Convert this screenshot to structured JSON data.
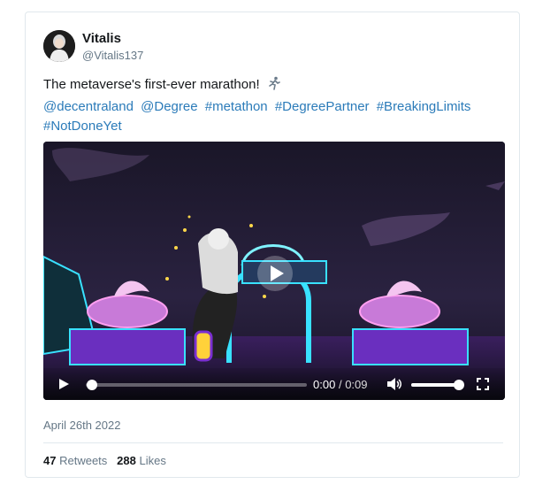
{
  "user": {
    "name": "Vitalis",
    "handle": "@Vitalis137"
  },
  "tweet": {
    "text": "The metaverse's first-ever marathon!",
    "emoji_icon": "person-running-icon",
    "links": [
      "@decentraland",
      "@Degree",
      "#metathon",
      "#DegreePartner",
      "#BreakingLimits",
      "#NotDoneYet"
    ]
  },
  "video": {
    "current_time": "0:00",
    "duration": "0:09",
    "separator": "/",
    "progress": 0.0,
    "volume": 1.0
  },
  "date": "April 26th 2022",
  "stats": {
    "retweets_count": "47",
    "retweets_label": "Retweets",
    "likes_count": "288",
    "likes_label": "Likes"
  },
  "colors": {
    "link": "#2b7bb9",
    "muted": "#657786",
    "neon_cyan": "#39e1ff",
    "neon_purple": "#a05cff"
  }
}
